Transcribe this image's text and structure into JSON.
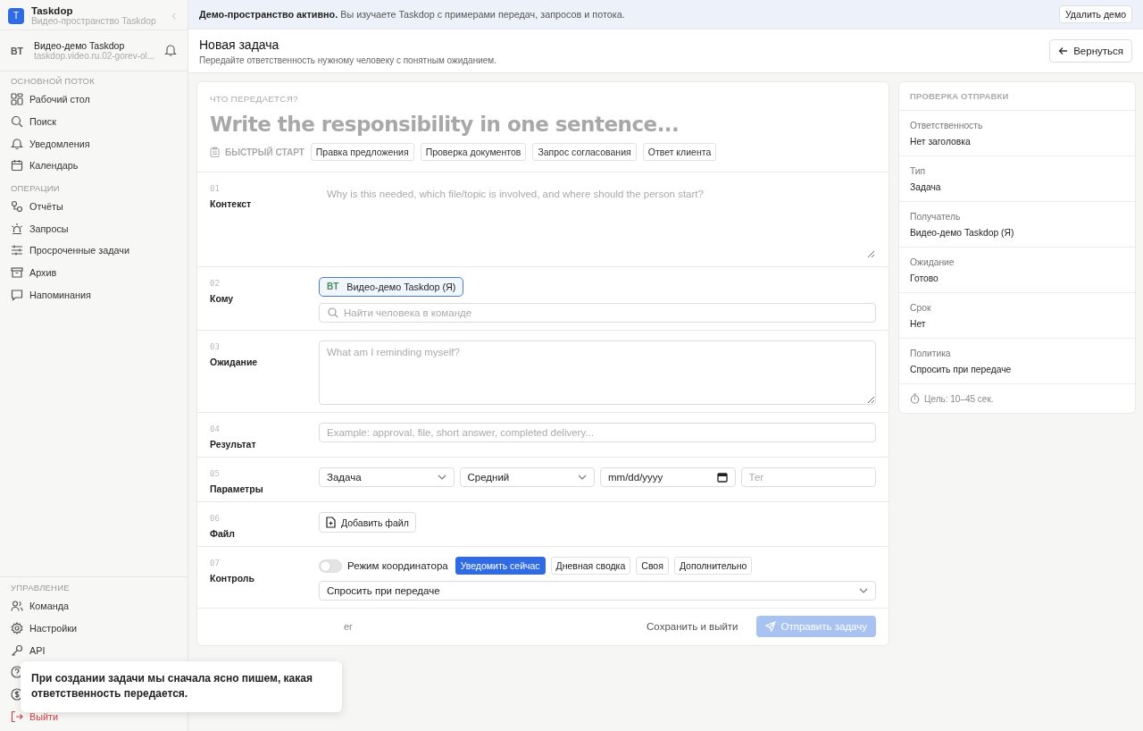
{
  "sidebar": {
    "workspace": {
      "initial": "T",
      "name": "Taskdop",
      "subtitle": "Видео-пространство Taskdop"
    },
    "user": {
      "initials": "BT",
      "name": "Видео-демо Taskdop",
      "email": "taskdop.video.ru.02-gorev-ol..."
    },
    "sections": [
      {
        "title": "ОСНОВНОЙ ПОТОК",
        "items": [
          "Рабочий стол",
          "Поиск",
          "Уведомления",
          "Календарь"
        ]
      },
      {
        "title": "ОПЕРАЦИИ",
        "items": [
          "Отчёты",
          "Запросы",
          "Просроченные задачи",
          "Архив",
          "Напоминания"
        ]
      }
    ],
    "manage": {
      "title": "УПРАВЛЕНИЕ",
      "items": [
        "Команда",
        "Настройки",
        "API"
      ]
    },
    "logout": "Выйти"
  },
  "banner": {
    "text": "**Демо-пространство активно.** Вы изучаете Taskdop с примерами передач, запросов и потока.",
    "button": "Удалить демо"
  },
  "header": {
    "title": "Новая задача",
    "subtitle": "Передайте ответственность нужному человеку с понятным ожиданием.",
    "back": "Вернуться"
  },
  "form": {
    "question": "ЧТО ПЕРЕДАЕТСЯ?",
    "title_placeholder": "Write the responsibility in one sentence...",
    "quick_start": "БЫСТРЫЙ СТАРТ",
    "chips": [
      "Правка предложения",
      "Проверка документов",
      "Запрос согласования",
      "Ответ клиента"
    ],
    "rows": [
      {
        "kind": "textarea",
        "number": "01",
        "label": "Контекст",
        "placeholder": "Why is this needed, which file/topic is involved, and where should the person start?"
      },
      {
        "kind": "recipient",
        "number": "02",
        "label": "Кому",
        "chip": {
          "initials": "BT",
          "name": "Видео-демо Taskdop (Я)"
        },
        "placeholder": "Найти человека в команде"
      },
      {
        "kind": "textarea",
        "number": "03",
        "label": "Ожидание",
        "placeholder": "What am I reminding myself?"
      },
      {
        "kind": "input",
        "number": "04",
        "label": "Результат",
        "placeholder": "Example: approval, file, short answer, completed delivery..."
      },
      {
        "kind": "params",
        "number": "05",
        "label": "Параметры",
        "selects": [
          "Задача",
          "Средний"
        ],
        "date": "mm/dd/yyyy",
        "tag_placeholder": "Тег"
      },
      {
        "kind": "file",
        "number": "06",
        "label": "Файл",
        "button": "Добавить файл"
      },
      {
        "kind": "control",
        "number": "07",
        "label": "Контроль",
        "toggle": {
          "label": "Режим координатора",
          "on": false
        },
        "options": [
          {
            "label": "Уведомить сейчас",
            "selected": true
          },
          {
            "label": "Дневная сводка",
            "selected": false
          },
          {
            "label": "Своя",
            "selected": false
          },
          {
            "label": "Дополнительно",
            "selected": false
          }
        ],
        "select": "Спросить при передаче"
      }
    ],
    "footer": {
      "note": "er",
      "save": "Сохранить и выйти",
      "submit": "Отправить задачу",
      "disabled": true
    }
  },
  "review": {
    "title": "ПРОВЕРКА ОТПРАВКИ",
    "items": [
      {
        "label": "Ответственность",
        "value": "Нет заголовка"
      },
      {
        "label": "Тип",
        "value": "Задача"
      },
      {
        "label": "Получатель",
        "value": "Видео-демо Taskdop (Я)"
      },
      {
        "label": "Ожидание",
        "value": "Готово"
      },
      {
        "label": "Срок",
        "value": "Нет"
      },
      {
        "label": "Политика",
        "value": "Спросить при передаче"
      }
    ],
    "goal": "Цель: 10–45 сек."
  },
  "toast": "При создании задачи мы сначала ясно пишем, какая ответственность передается."
}
